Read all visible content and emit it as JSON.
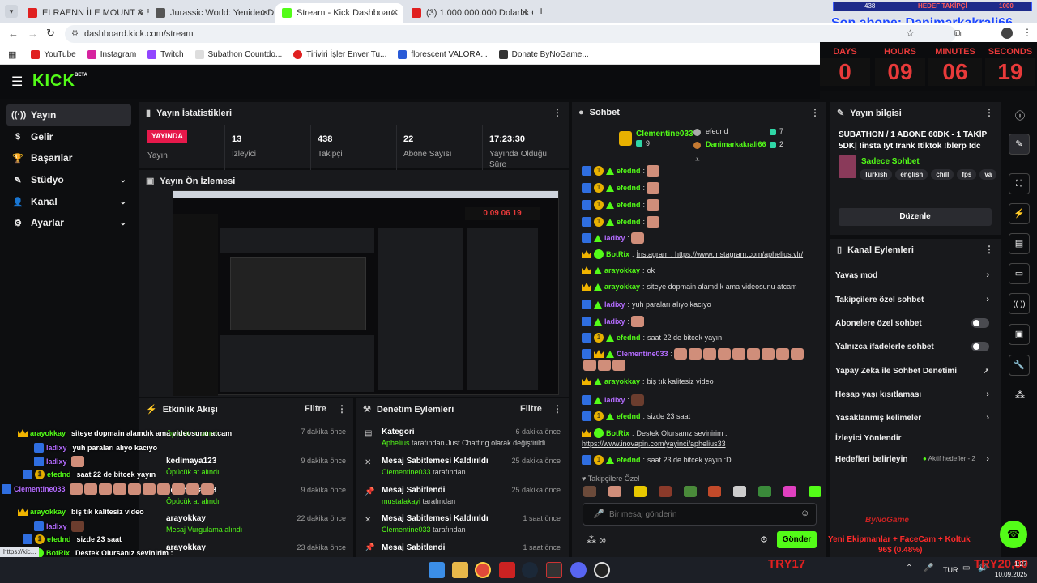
{
  "browser": {
    "tabs": [
      {
        "title": "ELRAENN İLE MOUNT & BLADE",
        "favicon_color": "#e02020"
      },
      {
        "title": "Jurassic World: Yeniden Doğuş",
        "favicon_color": "#555555"
      },
      {
        "title": "Stream - Kick Dashboard",
        "favicon_color": "#53fc18"
      },
      {
        "title": "(3) 1.000.000.000 Dolarlık Çikol",
        "favicon_color": "#e02020"
      }
    ],
    "url": "dashboard.kick.com/stream",
    "bookmarks": [
      "YouTube",
      "Instagram",
      "Twitch",
      "Subathon Countdo...",
      "Tiriviri İşler Enver Tu...",
      "florescent VALORA...",
      "Donate ByNoGame..."
    ]
  },
  "overlay": {
    "follower_goal_count": "438",
    "follower_goal_label": "HEDEF TAKİPÇİ",
    "follower_goal_target": "1000",
    "last_sub": "Son abone: Danimarkakrali66",
    "timer": {
      "labels": [
        "DAYS",
        "HOURS",
        "MINUTES",
        "SECONDS"
      ],
      "values": [
        "0",
        "09",
        "06",
        "19"
      ]
    },
    "donation_line1": "Yeni Ekipmanlar + FaceCam + Koltuk",
    "donation_line2": "96$ (0.48%)",
    "try_left": "TRY17",
    "try_right": "TRY20,00",
    "bynogame": "ByNoGame",
    "hover_url": "https://kic..."
  },
  "kick": {
    "logo": "KICK",
    "logo_beta": "BETA"
  },
  "sidebar": {
    "items": [
      {
        "label": "Yayın",
        "icon": "broadcast-icon",
        "active": true
      },
      {
        "label": "Gelir",
        "icon": "dollar-icon"
      },
      {
        "label": "Başarılar",
        "icon": "trophy-icon"
      },
      {
        "label": "Stüdyo",
        "icon": "pen-icon"
      },
      {
        "label": "Kanal",
        "icon": "user-icon"
      },
      {
        "label": "Ayarlar",
        "icon": "gear-icon"
      }
    ]
  },
  "stats": {
    "title": "Yayın İstatistikleri",
    "status_badge": "YAYINDA",
    "status_label": "Yayın",
    "viewers_value": "13",
    "viewers_label": "İzleyici",
    "followers_value": "438",
    "followers_label": "Takipçi",
    "subs_value": "22",
    "subs_label": "Abone Sayısı",
    "time_value": "17:23:30",
    "time_label": "Yayında Olduğu Süre"
  },
  "preview": {
    "title": "Yayın Ön İzlemesi"
  },
  "activity": {
    "title": "Etkinlik Akışı",
    "filter": "Filtre",
    "items": [
      {
        "name": "",
        "sub": "Öpücük at alındı",
        "time": "7 dakika önce"
      },
      {
        "name": "kedimaya123",
        "sub": "Öpücük at alındı",
        "time": "9 dakika önce"
      },
      {
        "name": "kedimaya123",
        "sub": "Öpücük at alındı",
        "time": "9 dakika önce"
      },
      {
        "name": "arayokkay",
        "sub": "Mesaj Vurgulama alındı",
        "time": "22 dakika önce"
      },
      {
        "name": "arayokkay",
        "sub": "",
        "time": "23 dakika önce"
      }
    ]
  },
  "moderation": {
    "title": "Denetim Eylemleri",
    "filter": "Filtre",
    "items": [
      {
        "name": "Kategori",
        "user": "Aphelius",
        "sub": "tarafından Just Chatting olarak değiştirildi",
        "time": "6 dakika önce"
      },
      {
        "name": "Mesaj Sabitlemesi Kaldırıldı",
        "user": "Clementine033",
        "sub": "tarafından",
        "time": "25 dakika önce"
      },
      {
        "name": "Mesaj Sabitlendi",
        "user": "mustafakayi",
        "sub": "tarafından",
        "time": "25 dakika önce"
      },
      {
        "name": "Mesaj Sabitlemesi Kaldırıldı",
        "user": "Clementine033",
        "sub": "tarafından",
        "time": "1 saat önce"
      },
      {
        "name": "Mesaj Sabitlendi",
        "user": "",
        "sub": "",
        "time": "1 saat önce"
      }
    ]
  },
  "chat": {
    "title": "Sohbet",
    "top_gifters": [
      {
        "name": "Clementine033",
        "count": "9"
      },
      {
        "name": "efednd",
        "count": "7"
      },
      {
        "name": "Danimarkakrali66",
        "count": "2"
      }
    ],
    "messages": [
      {
        "user": "efednd",
        "text": "",
        "emotes": 1
      },
      {
        "user": "efednd",
        "text": "",
        "emotes": 1
      },
      {
        "user": "efednd",
        "text": "",
        "emotes": 1
      },
      {
        "user": "efednd",
        "text": "",
        "emotes": 1
      },
      {
        "user": "ladixy",
        "text": "",
        "emotes": 1
      },
      {
        "user": "BotRix",
        "text": "İnstagram : https://www.instagram.com/aphelius.vlr/",
        "emotes": 0
      },
      {
        "user": "arayokkay",
        "text": "ok",
        "emotes": 0
      },
      {
        "user": "arayokkay",
        "text": "siteye dopmain alamdık ama videosunu atcam",
        "emotes": 0
      },
      {
        "user": "ladixy",
        "text": "yuh paraları alıyo kacıyo",
        "emotes": 0
      },
      {
        "user": "ladixy",
        "text": "",
        "emotes": 1
      },
      {
        "user": "efednd",
        "text": "saat 22 de bitcek yayın",
        "emotes": 0
      },
      {
        "user": "Clementine033",
        "text": "",
        "emotes": 12
      },
      {
        "user": "arayokkay",
        "text": "biş tık kalitesiz video",
        "emotes": 0
      },
      {
        "user": "ladixy",
        "text": "",
        "emotes": 1
      },
      {
        "user": "efednd",
        "text": "sizde 23 saat",
        "emotes": 0
      },
      {
        "user": "BotRix",
        "text": "Destek Olursanız sevinirim :",
        "emotes": 0
      },
      {
        "user": "",
        "text": "https://www.inovapin.com/yayinci/aphelius33",
        "emotes": 0
      },
      {
        "user": "efednd",
        "text": "saat 23 de bitcek yayın :D",
        "emotes": 0
      }
    ],
    "followers_only_label": "Takipçilere Özel",
    "input_placeholder": "Bir mesaj gönderin",
    "send_label": "Gönder"
  },
  "stream_info": {
    "title": "Yayın bilgisi",
    "stream_title": "SUBATHON / 1 ABONE 60DK - 1 TAKİP 5DK| !insta !yt !rank !tiktok !blerp !dc",
    "category": "Sadece Sohbet",
    "tags": [
      "Turkish",
      "english",
      "chill",
      "fps",
      "va"
    ],
    "edit_label": "Düzenle"
  },
  "channel_actions": {
    "title": "Kanal Eylemleri",
    "items": [
      {
        "label": "Yavaş mod",
        "kind": "chevron"
      },
      {
        "label": "Takipçilere özel sohbet",
        "kind": "chevron"
      },
      {
        "label": "Abonelere özel sohbet",
        "kind": "toggle"
      },
      {
        "label": "Yalnızca ifadelerle sohbet",
        "kind": "toggle"
      },
      {
        "label": "Yapay Zeka ile Sohbet Denetimi",
        "kind": "external"
      },
      {
        "label": "Hesap yaşı kısıtlaması",
        "kind": "chevron"
      },
      {
        "label": "Yasaklanmış kelimeler",
        "kind": "chevron"
      },
      {
        "label": "İzleyici Yönlendir",
        "kind": "none"
      },
      {
        "label": "Hedefleri belirleyin",
        "kind": "chevron"
      }
    ],
    "goals_status": "Aktif hedefler - 2"
  },
  "taskbar": {
    "lang": "TUR",
    "time": "1:27",
    "date": "10.09.2025"
  }
}
